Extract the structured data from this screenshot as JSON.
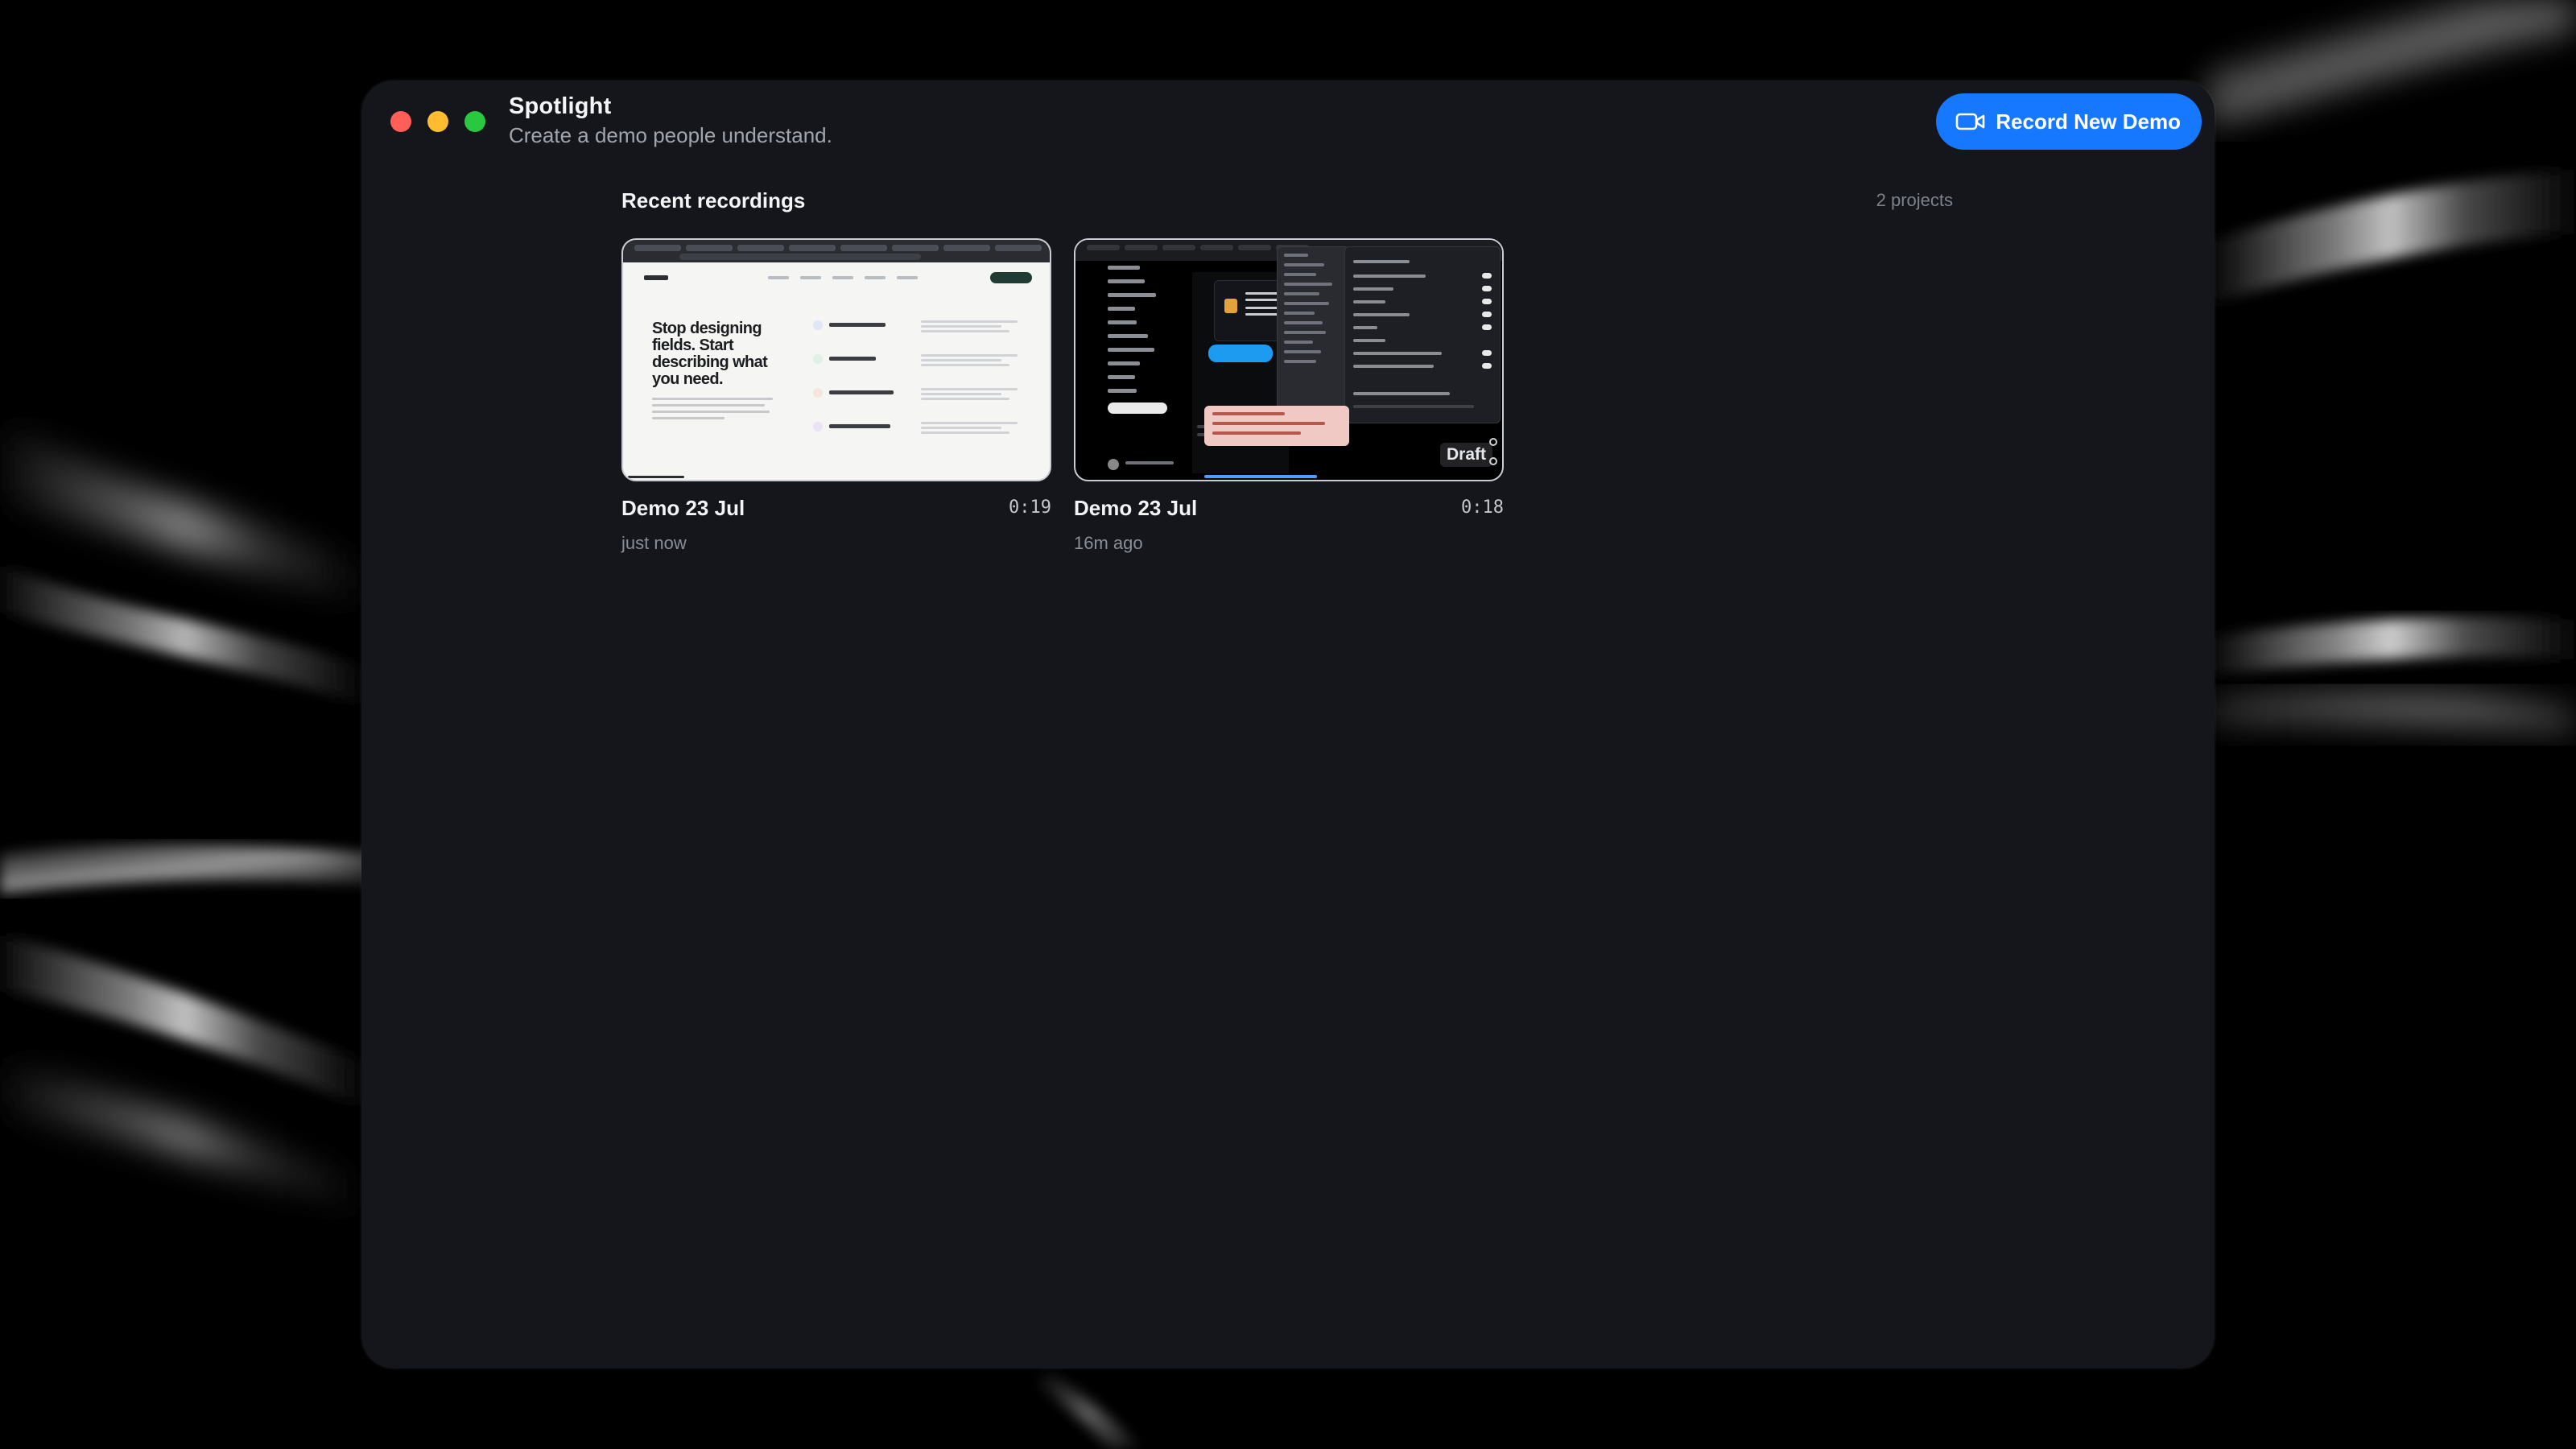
{
  "window": {
    "app_name": "Spotlight",
    "tagline": "Create a demo people understand.",
    "controls": [
      "close",
      "minimize",
      "zoom"
    ]
  },
  "toolbar": {
    "record_label": "Record New Demo",
    "record_icon": "video-camera-icon",
    "accent_color": "#1578ff"
  },
  "recent": {
    "title": "Recent recordings",
    "count_label": "2 projects"
  },
  "recordings": [
    {
      "title": "Demo 23 Jul",
      "duration": "0:19",
      "time_ago": "just now",
      "preview": {
        "hero_text": "Stop designing fields. Start describing what you need."
      }
    },
    {
      "title": "Demo 23 Jul",
      "duration": "0:18",
      "time_ago": "16m ago",
      "badge": "Draft"
    }
  ]
}
